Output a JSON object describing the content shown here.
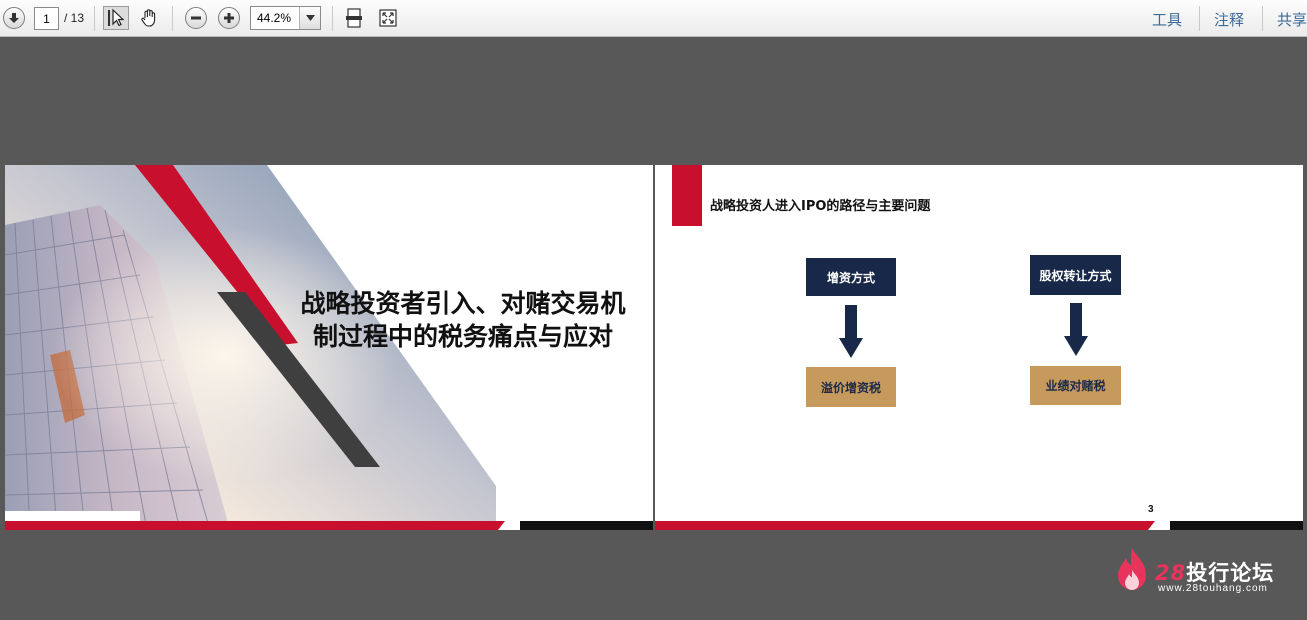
{
  "toolbar": {
    "current_page": "1",
    "page_total": "/ 13",
    "zoom_value": "44.2%",
    "tools_label": "工具",
    "comment_label": "注释",
    "share_label": "共享",
    "icons": [
      "page-down-icon",
      "select-cursor-icon",
      "hand-icon",
      "zoom-out-icon",
      "zoom-in-icon",
      "fit-page-icon",
      "fullscreen-icon"
    ]
  },
  "slide1": {
    "title_line1": "战略投资者引入、对赌交易机",
    "title_line2": "制过程中的税务痛点与应对"
  },
  "slide2": {
    "heading": "战略投资人进入IPO的路径与主要问题",
    "box_left_top": "增资方式",
    "box_left_bottom": "溢价增资税",
    "box_right_top": "股权转让方式",
    "box_right_bottom": "业绩对赌税",
    "page_number": "3"
  },
  "watermark": {
    "brand_number": "28",
    "brand_text": "投行论坛",
    "url": "www.28touhang.com"
  },
  "colors": {
    "viewer_bg": "#585858",
    "accent_red": "#c8102e",
    "navy": "#172848",
    "tan": "#c69a5d",
    "link_blue": "#3b6b98"
  }
}
